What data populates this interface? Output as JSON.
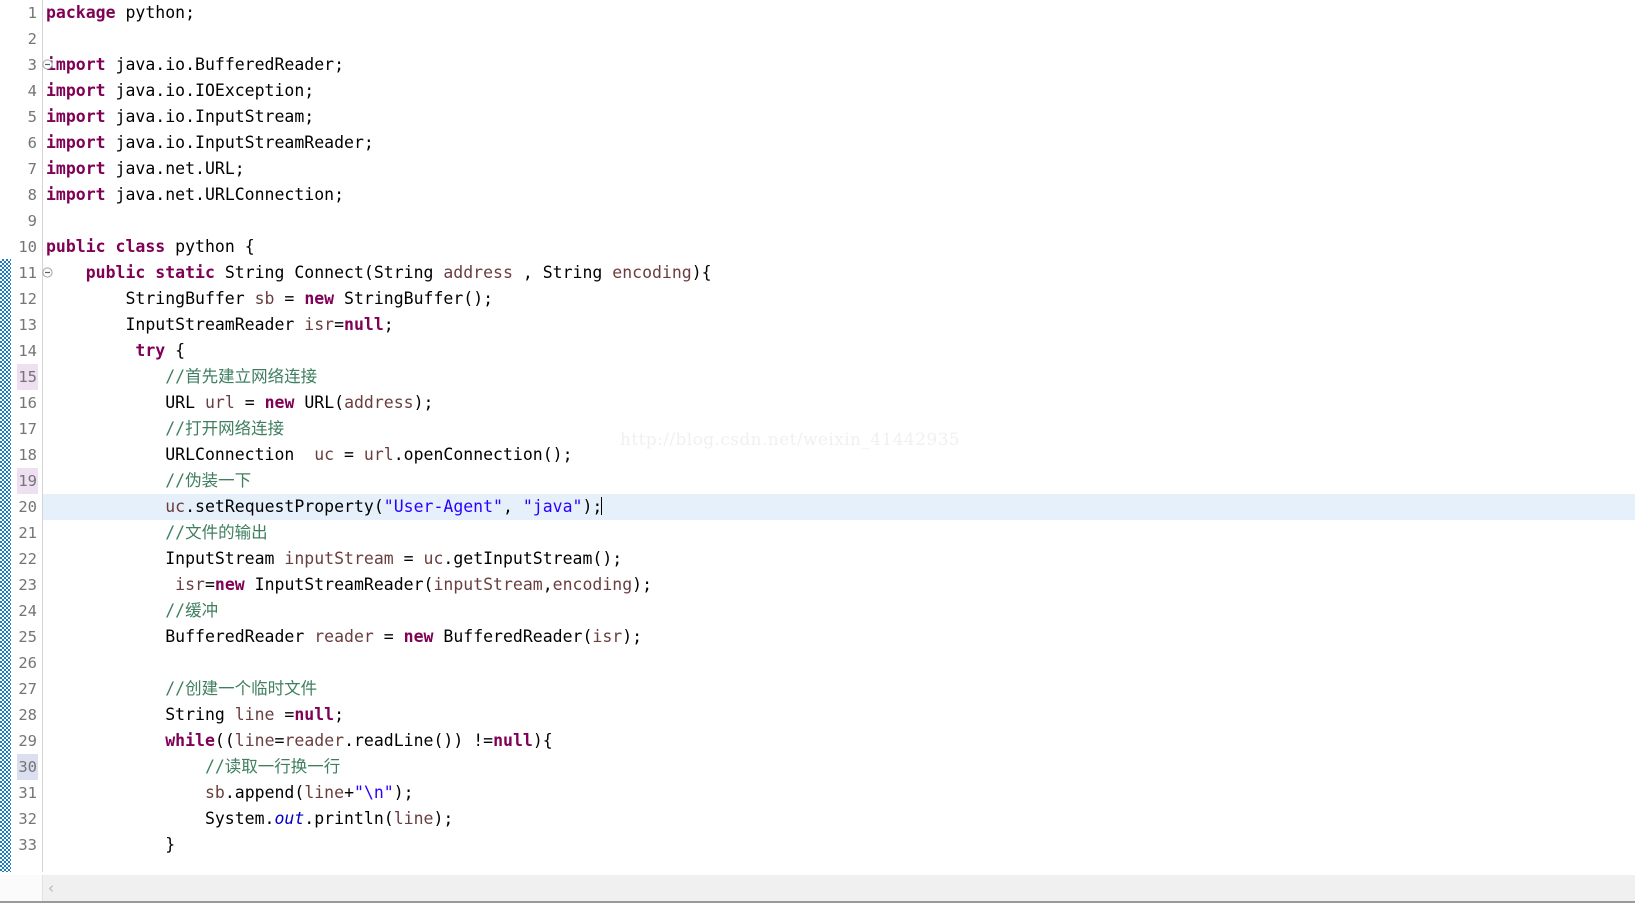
{
  "editor": {
    "language": "java",
    "font_size_px": 16.5,
    "line_height_px": 26,
    "colors": {
      "background": "#ffffff",
      "keyword": "#7f0055",
      "comment": "#3f7f5f",
      "string": "#2a00ff",
      "parameter": "#6a3e3e",
      "static_field": "#0000c0",
      "plain": "#000000",
      "line_number": "#757575",
      "current_line_highlight": "#e6f0fb",
      "gutter_marker_purple": "#eedff1",
      "gutter_marker_blue": "#dcdff0",
      "change_bar": "#1b7fc4",
      "gutter_separator": "#d4d4d4",
      "scrollbar_track": "#f0f0f0",
      "watermark": "#f0f0f0"
    },
    "current_line": 20,
    "caret_line": 20
  },
  "watermark": {
    "text": "http://blog.csdn.net/weixin_41442935"
  },
  "scrollbar": {
    "left_arrow_glyph": "‹",
    "orientation": "horizontal"
  },
  "lines": [
    {
      "number": "1",
      "fold": false,
      "change": false,
      "marker": "none",
      "current": false,
      "tokens": [
        {
          "t": "package",
          "c": "kw"
        },
        {
          "t": " python;",
          "c": "pln"
        }
      ]
    },
    {
      "number": "2",
      "fold": false,
      "change": false,
      "marker": "none",
      "current": false,
      "tokens": []
    },
    {
      "number": "3",
      "fold": true,
      "change": false,
      "marker": "none",
      "current": false,
      "tokens": [
        {
          "t": "import",
          "c": "kw"
        },
        {
          "t": " java.io.BufferedReader;",
          "c": "pln"
        }
      ]
    },
    {
      "number": "4",
      "fold": false,
      "change": false,
      "marker": "none",
      "current": false,
      "tokens": [
        {
          "t": "import",
          "c": "kw"
        },
        {
          "t": " java.io.IOException;",
          "c": "pln"
        }
      ]
    },
    {
      "number": "5",
      "fold": false,
      "change": false,
      "marker": "none",
      "current": false,
      "tokens": [
        {
          "t": "import",
          "c": "kw"
        },
        {
          "t": " java.io.InputStream;",
          "c": "pln"
        }
      ]
    },
    {
      "number": "6",
      "fold": false,
      "change": false,
      "marker": "none",
      "current": false,
      "tokens": [
        {
          "t": "import",
          "c": "kw"
        },
        {
          "t": " java.io.InputStreamReader;",
          "c": "pln"
        }
      ]
    },
    {
      "number": "7",
      "fold": false,
      "change": false,
      "marker": "none",
      "current": false,
      "tokens": [
        {
          "t": "import",
          "c": "kw"
        },
        {
          "t": " java.net.URL;",
          "c": "pln"
        }
      ]
    },
    {
      "number": "8",
      "fold": false,
      "change": false,
      "marker": "none",
      "current": false,
      "tokens": [
        {
          "t": "import",
          "c": "kw"
        },
        {
          "t": " java.net.URLConnection;",
          "c": "pln"
        }
      ]
    },
    {
      "number": "9",
      "fold": false,
      "change": false,
      "marker": "none",
      "current": false,
      "tokens": []
    },
    {
      "number": "10",
      "fold": false,
      "change": false,
      "marker": "none",
      "current": false,
      "tokens": [
        {
          "t": "public class",
          "c": "kw"
        },
        {
          "t": " python {",
          "c": "pln"
        }
      ]
    },
    {
      "number": "11",
      "fold": true,
      "change": true,
      "marker": "none",
      "current": false,
      "tokens": [
        {
          "t": "    ",
          "c": "pln"
        },
        {
          "t": "public static",
          "c": "kw"
        },
        {
          "t": " String Connect(String ",
          "c": "pln"
        },
        {
          "t": "address",
          "c": "par"
        },
        {
          "t": " , String ",
          "c": "pln"
        },
        {
          "t": "encoding",
          "c": "par"
        },
        {
          "t": "){",
          "c": "pln"
        }
      ]
    },
    {
      "number": "12",
      "fold": false,
      "change": true,
      "marker": "none",
      "current": false,
      "tokens": [
        {
          "t": "        StringBuffer ",
          "c": "pln"
        },
        {
          "t": "sb",
          "c": "par"
        },
        {
          "t": " = ",
          "c": "pln"
        },
        {
          "t": "new",
          "c": "kw"
        },
        {
          "t": " StringBuffer();",
          "c": "pln"
        }
      ]
    },
    {
      "number": "13",
      "fold": false,
      "change": true,
      "marker": "none",
      "current": false,
      "tokens": [
        {
          "t": "        InputStreamReader ",
          "c": "pln"
        },
        {
          "t": "isr",
          "c": "par"
        },
        {
          "t": "=",
          "c": "pln"
        },
        {
          "t": "null",
          "c": "kw"
        },
        {
          "t": ";",
          "c": "pln"
        }
      ]
    },
    {
      "number": "14",
      "fold": false,
      "change": true,
      "marker": "none",
      "current": false,
      "tokens": [
        {
          "t": "         ",
          "c": "pln"
        },
        {
          "t": "try",
          "c": "kw"
        },
        {
          "t": " {",
          "c": "pln"
        }
      ]
    },
    {
      "number": "15",
      "fold": false,
      "change": true,
      "marker": "purple",
      "current": false,
      "tokens": [
        {
          "t": "            //首先建立网络连接",
          "c": "cmt"
        }
      ]
    },
    {
      "number": "16",
      "fold": false,
      "change": true,
      "marker": "none",
      "current": false,
      "tokens": [
        {
          "t": "            URL ",
          "c": "pln"
        },
        {
          "t": "url",
          "c": "par"
        },
        {
          "t": " = ",
          "c": "pln"
        },
        {
          "t": "new",
          "c": "kw"
        },
        {
          "t": " URL(",
          "c": "pln"
        },
        {
          "t": "address",
          "c": "par"
        },
        {
          "t": ");",
          "c": "pln"
        }
      ]
    },
    {
      "number": "17",
      "fold": false,
      "change": true,
      "marker": "none",
      "current": false,
      "tokens": [
        {
          "t": "            //打开网络连接",
          "c": "cmt"
        }
      ]
    },
    {
      "number": "18",
      "fold": false,
      "change": true,
      "marker": "none",
      "current": false,
      "tokens": [
        {
          "t": "            URLConnection  ",
          "c": "pln"
        },
        {
          "t": "uc",
          "c": "par"
        },
        {
          "t": " = ",
          "c": "pln"
        },
        {
          "t": "url",
          "c": "par"
        },
        {
          "t": ".openConnection();",
          "c": "pln"
        }
      ]
    },
    {
      "number": "19",
      "fold": false,
      "change": true,
      "marker": "purple",
      "current": false,
      "tokens": [
        {
          "t": "            //伪装一下",
          "c": "cmt"
        }
      ]
    },
    {
      "number": "20",
      "fold": false,
      "change": true,
      "marker": "none",
      "current": true,
      "caret": true,
      "tokens": [
        {
          "t": "            ",
          "c": "pln"
        },
        {
          "t": "uc",
          "c": "par"
        },
        {
          "t": ".setRequestProperty(",
          "c": "pln"
        },
        {
          "t": "\"User-Agent\"",
          "c": "str"
        },
        {
          "t": ", ",
          "c": "pln"
        },
        {
          "t": "\"java\"",
          "c": "str"
        },
        {
          "t": ");",
          "c": "pln"
        }
      ]
    },
    {
      "number": "21",
      "fold": false,
      "change": true,
      "marker": "none",
      "current": false,
      "tokens": [
        {
          "t": "            //文件的输出",
          "c": "cmt"
        }
      ]
    },
    {
      "number": "22",
      "fold": false,
      "change": true,
      "marker": "none",
      "current": false,
      "tokens": [
        {
          "t": "            InputStream ",
          "c": "pln"
        },
        {
          "t": "inputStream",
          "c": "par"
        },
        {
          "t": " = ",
          "c": "pln"
        },
        {
          "t": "uc",
          "c": "par"
        },
        {
          "t": ".getInputStream();",
          "c": "pln"
        }
      ]
    },
    {
      "number": "23",
      "fold": false,
      "change": true,
      "marker": "none",
      "current": false,
      "tokens": [
        {
          "t": "             ",
          "c": "pln"
        },
        {
          "t": "isr",
          "c": "par"
        },
        {
          "t": "=",
          "c": "pln"
        },
        {
          "t": "new",
          "c": "kw"
        },
        {
          "t": " InputStreamReader(",
          "c": "pln"
        },
        {
          "t": "inputStream",
          "c": "par"
        },
        {
          "t": ",",
          "c": "pln"
        },
        {
          "t": "encoding",
          "c": "par"
        },
        {
          "t": ");",
          "c": "pln"
        }
      ]
    },
    {
      "number": "24",
      "fold": false,
      "change": true,
      "marker": "none",
      "current": false,
      "tokens": [
        {
          "t": "            //缓冲",
          "c": "cmt"
        }
      ]
    },
    {
      "number": "25",
      "fold": false,
      "change": true,
      "marker": "none",
      "current": false,
      "tokens": [
        {
          "t": "            BufferedReader ",
          "c": "pln"
        },
        {
          "t": "reader",
          "c": "par"
        },
        {
          "t": " = ",
          "c": "pln"
        },
        {
          "t": "new",
          "c": "kw"
        },
        {
          "t": " BufferedReader(",
          "c": "pln"
        },
        {
          "t": "isr",
          "c": "par"
        },
        {
          "t": ");",
          "c": "pln"
        }
      ]
    },
    {
      "number": "26",
      "fold": false,
      "change": true,
      "marker": "none",
      "current": false,
      "tokens": []
    },
    {
      "number": "27",
      "fold": false,
      "change": true,
      "marker": "none",
      "current": false,
      "tokens": [
        {
          "t": "            //创建一个临时文件",
          "c": "cmt"
        }
      ]
    },
    {
      "number": "28",
      "fold": false,
      "change": true,
      "marker": "none",
      "current": false,
      "tokens": [
        {
          "t": "            String ",
          "c": "pln"
        },
        {
          "t": "line",
          "c": "par"
        },
        {
          "t": " =",
          "c": "pln"
        },
        {
          "t": "null",
          "c": "kw"
        },
        {
          "t": ";",
          "c": "pln"
        }
      ]
    },
    {
      "number": "29",
      "fold": false,
      "change": true,
      "marker": "none",
      "current": false,
      "tokens": [
        {
          "t": "            ",
          "c": "pln"
        },
        {
          "t": "while",
          "c": "kw"
        },
        {
          "t": "((",
          "c": "pln"
        },
        {
          "t": "line",
          "c": "par"
        },
        {
          "t": "=",
          "c": "pln"
        },
        {
          "t": "reader",
          "c": "par"
        },
        {
          "t": ".readLine()) !=",
          "c": "pln"
        },
        {
          "t": "null",
          "c": "kw"
        },
        {
          "t": "){",
          "c": "pln"
        }
      ]
    },
    {
      "number": "30",
      "fold": false,
      "change": true,
      "marker": "blue",
      "current": false,
      "tokens": [
        {
          "t": "                //读取一行换一行",
          "c": "cmt"
        }
      ]
    },
    {
      "number": "31",
      "fold": false,
      "change": true,
      "marker": "none",
      "current": false,
      "tokens": [
        {
          "t": "                ",
          "c": "pln"
        },
        {
          "t": "sb",
          "c": "par"
        },
        {
          "t": ".append(",
          "c": "pln"
        },
        {
          "t": "line",
          "c": "par"
        },
        {
          "t": "+",
          "c": "pln"
        },
        {
          "t": "\"\\n\"",
          "c": "str"
        },
        {
          "t": ");",
          "c": "pln"
        }
      ]
    },
    {
      "number": "32",
      "fold": false,
      "change": true,
      "marker": "none",
      "current": false,
      "tokens": [
        {
          "t": "                System.",
          "c": "pln"
        },
        {
          "t": "out",
          "c": "fld"
        },
        {
          "t": ".println(",
          "c": "pln"
        },
        {
          "t": "line",
          "c": "par"
        },
        {
          "t": ");",
          "c": "pln"
        }
      ]
    },
    {
      "number": "33",
      "fold": false,
      "change": true,
      "marker": "none",
      "current": false,
      "tokens": [
        {
          "t": "            }",
          "c": "pln"
        }
      ]
    }
  ]
}
